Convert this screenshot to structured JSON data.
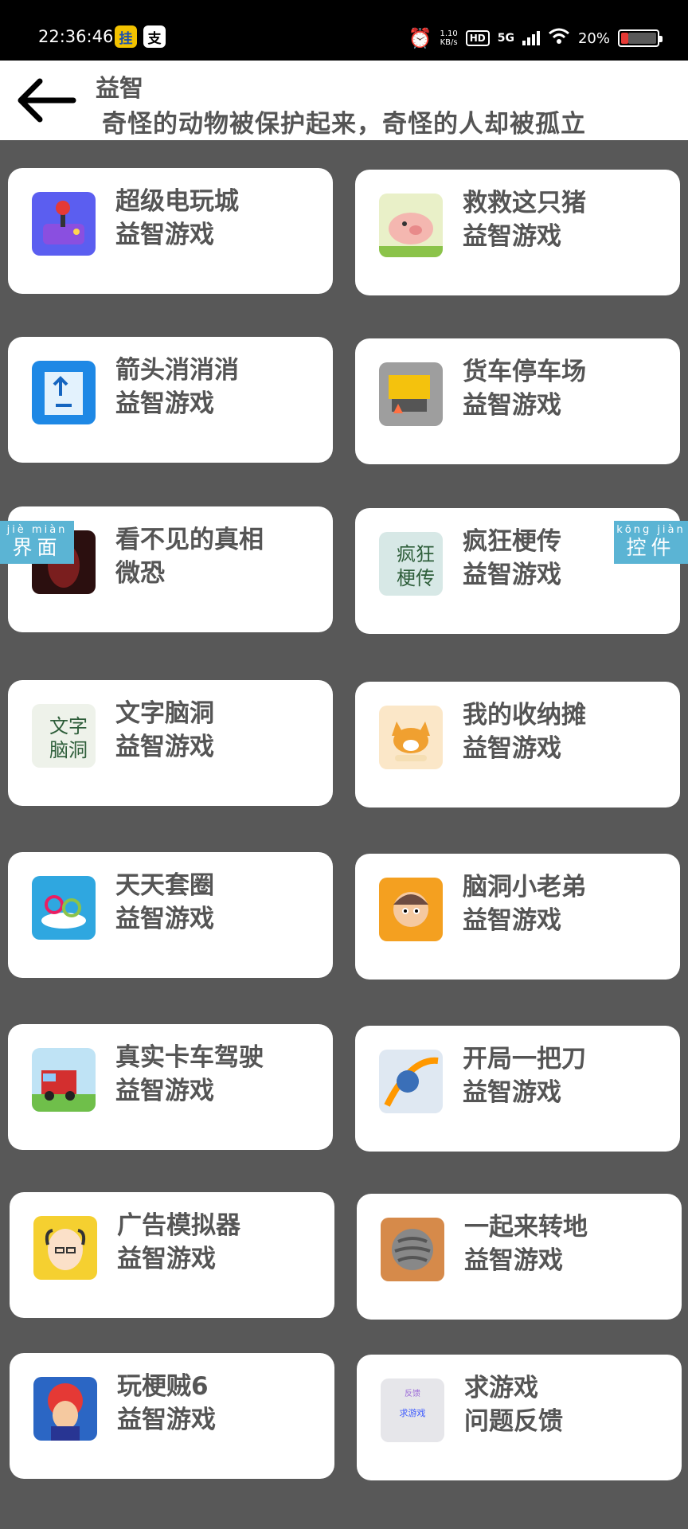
{
  "status_bar": {
    "time": "22:36:46",
    "app_icons": [
      "挂",
      "支"
    ],
    "net_speed_value": "1.10",
    "net_speed_unit": "KB/s",
    "hd_label": "HD",
    "network_label": "5G",
    "battery_text": "20%",
    "battery_level": 0.2,
    "battery_color": "#e53935"
  },
  "header": {
    "title": "益智",
    "subtitle": "奇怪的动物被保护起来，奇怪的人却被孤立"
  },
  "side_tags": {
    "left": {
      "pinyin": "jiè miàn",
      "text": "界面"
    },
    "right": {
      "pinyin": "kōng jiàn",
      "text": "控件"
    }
  },
  "games": [
    {
      "title": "超级电玩城",
      "subtitle": "益智游戏",
      "icon": "arcade-joystick-icon",
      "color": "#5b5ef0"
    },
    {
      "title": "救救这只猪",
      "subtitle": "益智游戏",
      "icon": "pig-icon",
      "color": "#f4b7b0"
    },
    {
      "title": "箭头消消消",
      "subtitle": "益智游戏",
      "icon": "arrow-blocks-icon",
      "color": "#1e88e5"
    },
    {
      "title": "货车停车场",
      "subtitle": "益智游戏",
      "icon": "truck-parking-icon",
      "color": "#f4c20d"
    },
    {
      "title": "看不见的真相",
      "subtitle": "微恐",
      "icon": "horror-figure-icon",
      "color": "#7a1e1e"
    },
    {
      "title": "疯狂梗传",
      "subtitle": "益智游戏",
      "icon": "meme-calligraphy-icon",
      "color": "#d7e8e6",
      "icon_text": "疯狂梗传"
    },
    {
      "title": "文字脑洞",
      "subtitle": "益智游戏",
      "icon": "word-calligraphy-icon",
      "color": "#eef2ea",
      "icon_text": "文字脑洞"
    },
    {
      "title": "我的收纳摊",
      "subtitle": "益智游戏",
      "icon": "corgi-dog-icon",
      "color": "#f0a030"
    },
    {
      "title": "天天套圈",
      "subtitle": "益智游戏",
      "icon": "ring-toss-icon",
      "color": "#2fa7e0"
    },
    {
      "title": "脑洞小老弟",
      "subtitle": "益智游戏",
      "icon": "cartoon-boy-icon",
      "color": "#f4a020"
    },
    {
      "title": "真实卡车驾驶",
      "subtitle": "益智游戏",
      "icon": "red-truck-icon",
      "color": "#6fbf4a"
    },
    {
      "title": "开局一把刀",
      "subtitle": "益智游戏",
      "icon": "ninja-knife-icon",
      "color": "#3a6fb8"
    },
    {
      "title": "广告模拟器",
      "subtitle": "益智游戏",
      "icon": "bald-man-icon",
      "color": "#f5d030"
    },
    {
      "title": "一起来转地",
      "subtitle": "益智游戏",
      "icon": "drill-icon",
      "color": "#c8661e"
    },
    {
      "title": "玩梗贼6",
      "subtitle": "益智游戏",
      "icon": "red-hair-thief-icon",
      "color": "#2b66c4"
    },
    {
      "title": "求游戏",
      "subtitle": "问题反馈",
      "icon": "feedback-icon",
      "color": "#e6e6ea",
      "icon_text": "求游戏",
      "icon_badge": "反馈"
    }
  ]
}
